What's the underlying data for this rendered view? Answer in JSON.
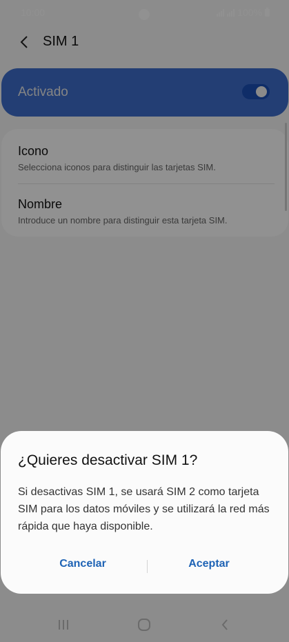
{
  "status_bar": {
    "time": "10:00",
    "battery": "100%"
  },
  "header": {
    "title": "SIM 1",
    "back_icon": "chevron-left-icon"
  },
  "toggle": {
    "label": "Activado",
    "on": true,
    "accent_color": "#3e6ecc"
  },
  "settings": {
    "items": [
      {
        "title": "Icono",
        "subtitle": "Selecciona iconos para distinguir las tarjetas SIM."
      },
      {
        "title": "Nombre",
        "subtitle": "Introduce un nombre para distinguir esta tarjeta SIM."
      }
    ]
  },
  "dialog": {
    "title": "¿Quieres desactivar SIM 1?",
    "message": "Si desactivas SIM 1, se usará SIM 2 como tarjeta SIM para los datos móviles y se utilizará la red más rápida que haya disponible.",
    "cancel_label": "Cancelar",
    "accept_label": "Aceptar",
    "button_color": "#1e63b5"
  },
  "nav_bar": {
    "recents_icon": "recent-apps-icon",
    "home_icon": "home-icon",
    "back_icon": "back-icon"
  }
}
